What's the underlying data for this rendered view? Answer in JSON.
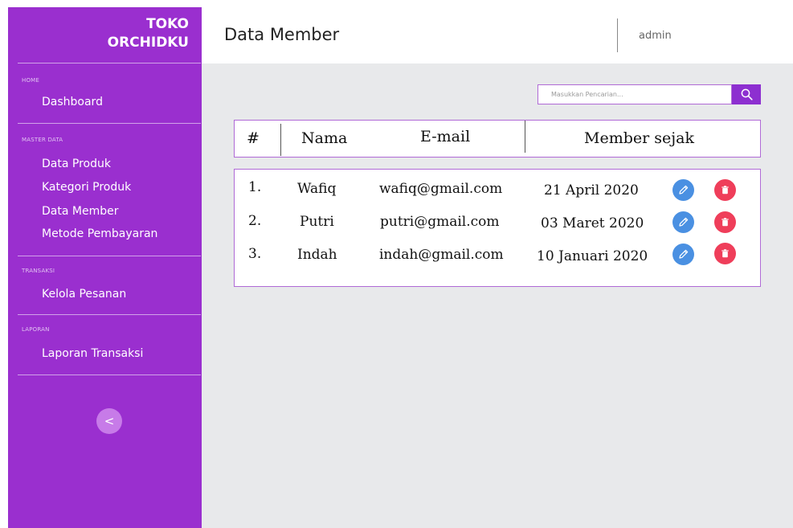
{
  "brand": {
    "line1": "TOKO",
    "line2": "ORCHIDKU"
  },
  "sidebar": {
    "sections": [
      {
        "title": "HOME",
        "items": [
          "Dashboard"
        ]
      },
      {
        "title": "MASTER DATA",
        "items": [
          "Data Produk",
          "Kategori Produk",
          "Data Member",
          "Metode Pembayaran"
        ]
      },
      {
        "title": "TRANSAKSI",
        "items": [
          "Kelola Pesanan"
        ]
      },
      {
        "title": "LAPORAN",
        "items": [
          "Laporan Transaksi"
        ]
      }
    ],
    "collapse_label": "<"
  },
  "header": {
    "title": "Data Member",
    "user": "admin"
  },
  "search": {
    "placeholder": "Masukkan Pencarian..."
  },
  "table": {
    "columns": [
      "#",
      "Nama",
      "E-mail",
      "Member sejak"
    ],
    "rows": [
      {
        "no": "1.",
        "name": "Wafiq",
        "email": "wafiq@gmail.com",
        "since": "21 April 2020"
      },
      {
        "no": "2.",
        "name": "Putri",
        "email": "putri@gmail.com",
        "since": "03 Maret 2020"
      },
      {
        "no": "3.",
        "name": "Indah",
        "email": "indah@gmail.com",
        "since": "10 Januari 2020"
      }
    ]
  },
  "colors": {
    "sidebar": "#9a2fcf",
    "accent": "#8d2fd0",
    "edit": "#4a90e2",
    "delete": "#ef3e5a",
    "background": "#e8e9eb"
  },
  "icons": {
    "search": "search-icon",
    "edit": "pencil-icon",
    "delete": "trash-icon"
  }
}
